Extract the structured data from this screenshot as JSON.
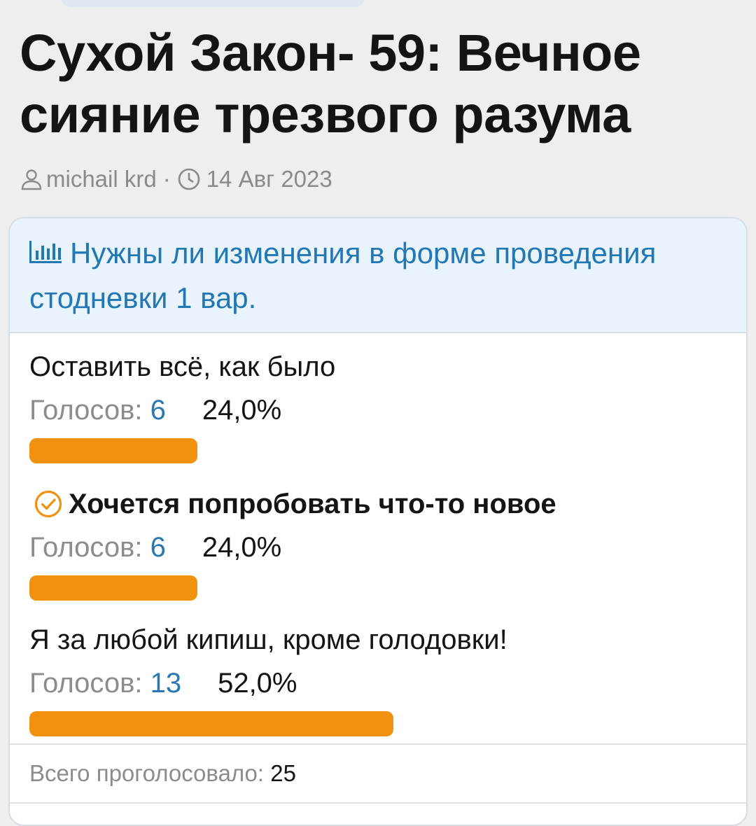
{
  "article": {
    "title": "Сухой Закон- 59: Вечное сияние трезвого разума",
    "author": "michail krd",
    "separator": "·",
    "date": "14 Авг 2023"
  },
  "poll": {
    "icon": "bar-chart-icon",
    "question": "Нужны ли изменения в форме проведения стодневки 1 вар.",
    "votes_label": "Голосов:",
    "accent_color": "#f0920f",
    "link_color": "#2277b5",
    "options": [
      {
        "label": "Оставить всё, как было",
        "votes": "6",
        "percent": "24,0%",
        "share": 0.24,
        "chosen": false
      },
      {
        "label": "Хочется попробовать что-то новое",
        "votes": "6",
        "percent": "24,0%",
        "share": 0.24,
        "chosen": true,
        "chosen_icon": "check-circle-icon"
      },
      {
        "label": "Я за любой кипиш, кроме голодовки!",
        "votes": "13",
        "percent": "52,0%",
        "share": 0.52,
        "chosen": false
      }
    ],
    "total_label": "Всего проголосовало:",
    "total": "25"
  }
}
